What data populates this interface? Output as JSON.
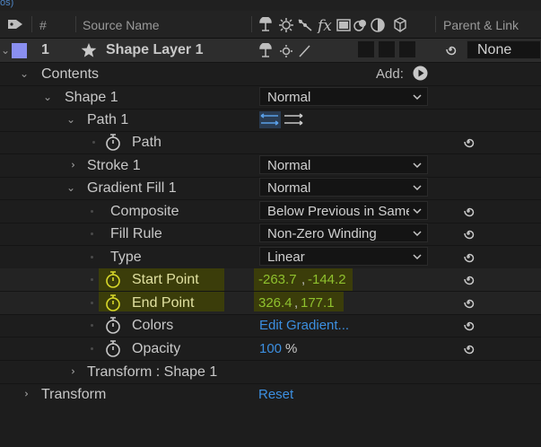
{
  "top_fragment": "os)",
  "header": {
    "number": "#",
    "source_name": "Source Name",
    "parent_link": "Parent & Link"
  },
  "layer": {
    "index": "1",
    "name": "Shape Layer 1",
    "label_color": "#8a8ff0",
    "parent_value": "None"
  },
  "contents": {
    "label": "Contents",
    "add_label": "Add:"
  },
  "shape1": {
    "label": "Shape 1",
    "blend": "Normal"
  },
  "path1": {
    "label": "Path 1"
  },
  "path": {
    "label": "Path"
  },
  "stroke1": {
    "label": "Stroke 1",
    "blend": "Normal"
  },
  "gradient_fill1": {
    "label": "Gradient Fill 1",
    "blend": "Normal",
    "composite_label": "Composite",
    "composite_value": "Below Previous in Same Group",
    "fill_rule_label": "Fill Rule",
    "fill_rule_value": "Non-Zero Winding",
    "type_label": "Type",
    "type_value": "Linear",
    "start_point_label": "Start Point",
    "start_point_x": "-263.7",
    "start_point_y": "-144.2",
    "end_point_label": "End Point",
    "end_point_x": "326.4",
    "end_point_y": "177.1",
    "colors_label": "Colors",
    "colors_value": "Edit Gradient...",
    "opacity_label": "Opacity",
    "opacity_value": "100",
    "opacity_unit": "%"
  },
  "transform_shape": {
    "label": "Transform : Shape 1"
  },
  "transform": {
    "label": "Transform",
    "reset": "Reset"
  },
  "colors": {
    "highlight": "#3b3d0a",
    "value_blue": "#3c8fe0",
    "value_green": "#8fc12e"
  }
}
